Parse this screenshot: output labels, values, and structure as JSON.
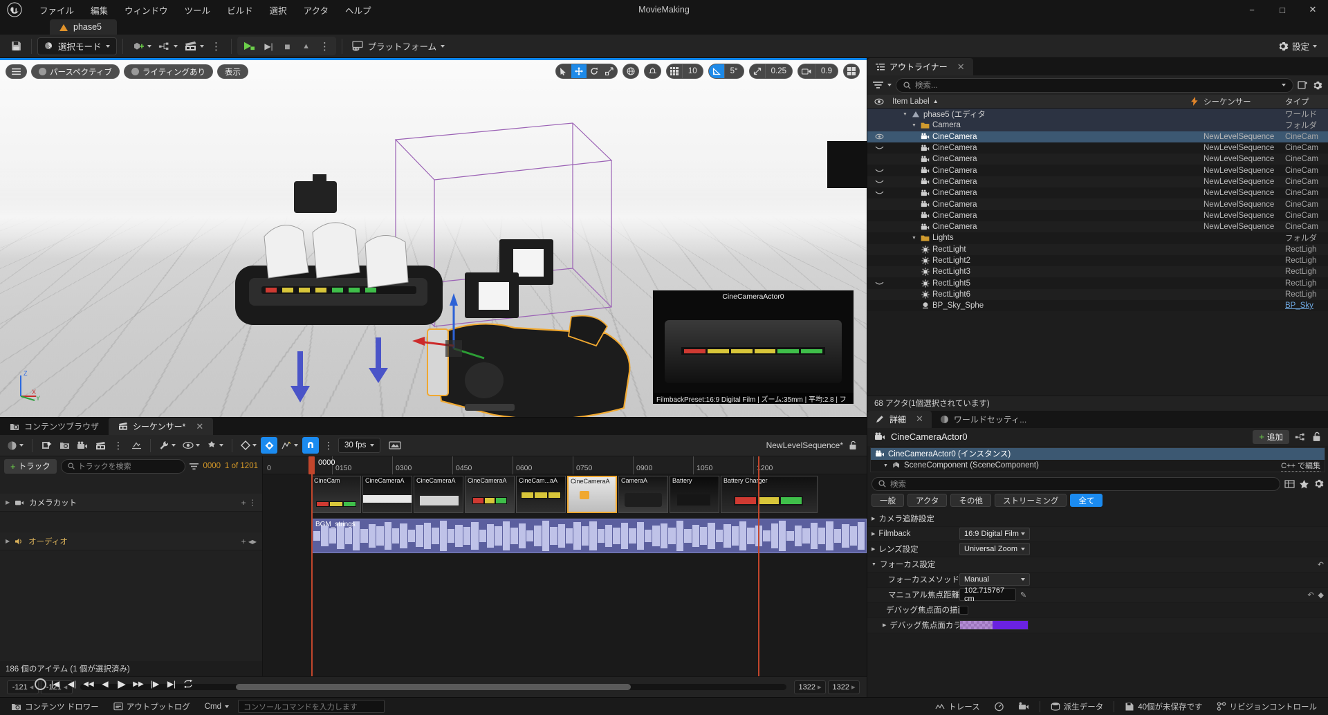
{
  "window": {
    "project_title": "MovieMaking",
    "menus": [
      "ファイル",
      "編集",
      "ウィンドウ",
      "ツール",
      "ビルド",
      "選択",
      "アクタ",
      "ヘルプ"
    ],
    "level_tab": "phase5",
    "minimize": "−",
    "maximize": "□",
    "close": "✕"
  },
  "toolbar": {
    "save_icon": "save-icon",
    "mode_label": "選択モード",
    "add_icon": "add-actor-icon",
    "blueprint_icon": "blueprint-icon",
    "sequencer_icon": "cinematics-icon",
    "play_icon": "▶",
    "skip_icon": "▶|",
    "stop_icon": "■",
    "eject_icon": "▲",
    "more_icon": "⋮",
    "platform_label": "プラットフォーム",
    "settings_label": "設定"
  },
  "viewport": {
    "perspective_label": "パースペクティブ",
    "lighting_label": "ライティングあり",
    "show_label": "表示",
    "controls": {
      "select_icon": "cursor-icon",
      "move_icon": "move-gizmo-icon",
      "rotate_icon": "rotate-gizmo-icon",
      "scale_icon": "scale-gizmo-icon",
      "world_icon": "world-space-icon",
      "surface_icon": "surface-snap-icon",
      "grid_snap_value": "10",
      "angle_snap_value": "5°",
      "scale_snap_value": "0.25",
      "camera_speed_value": "0.9",
      "layout_icon": "viewport-layout-icon"
    },
    "axis": {
      "x": "X",
      "y": "Y",
      "z": "Z"
    },
    "pip": {
      "title": "CineCameraActor0",
      "footer": "FilmbackPreset:16:9 Digital Film | ズーム:35mm | 平均:2.8 | フ"
    }
  },
  "sequencer": {
    "tabs": [
      {
        "label": "コンテンツブラウザ",
        "icon": "content-browser-icon",
        "active": false
      },
      {
        "label": "シーケンサー*",
        "icon": "sequencer-icon",
        "active": true,
        "close": "✕"
      }
    ],
    "toolbar": {
      "world_icon": "world-icon",
      "new_icon": "new-sequence-icon",
      "open_icon": "open-sequence-icon",
      "camera_icon": "create-camera-icon",
      "clapper_icon": "clapper-icon",
      "more_icon": "⋮",
      "actions_icon": "actions-icon",
      "wrench_icon": "wrench-icon",
      "eye_icon": "visibility-icon",
      "keyframe_opts_icon": "key-options-icon",
      "diamond_icon": "keyframe-icon",
      "auto_key_icon": "autokey-icon",
      "curve_icon": "curve-editor-icon",
      "snap_icon": "snap-magnet-icon",
      "fps_label": "30 fps",
      "render_icon": "render-movie-icon",
      "sequence_name": "NewLevelSequence*",
      "lock_icon": "unlock-icon"
    },
    "track_panel": {
      "add_track_label": "トラック",
      "search_placeholder": "トラックを検索",
      "filter_icon": "filter-icon",
      "current_frame": "0000",
      "frame_range": "1 of 1201",
      "tracks": [
        {
          "label": "カメラカット",
          "icon": "camera-cut-icon",
          "type": "camcut"
        },
        {
          "label": "オーディオ",
          "icon": "audio-icon",
          "type": "audio"
        }
      ],
      "status": "186 個のアイテム (1 個が選択済み)"
    },
    "ruler": {
      "ticks": [
        "0150",
        "0300",
        "0450",
        "0600",
        "0750",
        "0900",
        "1050",
        "1200"
      ],
      "playhead_label": "0000",
      "start_label": "0"
    },
    "shots": [
      {
        "name": "CineCam",
        "selected": false
      },
      {
        "name": "CineCameraA",
        "selected": false
      },
      {
        "name": "CineCameraA",
        "selected": false
      },
      {
        "name": "CineCameraA",
        "selected": false
      },
      {
        "name": "CineCam...aA",
        "selected": false
      },
      {
        "name": "CineCameraA",
        "selected": true
      },
      {
        "name": "CameraA",
        "selected": false
      },
      {
        "name": "Battery",
        "selected": false
      },
      {
        "name": "Battery Charger",
        "selected": false
      }
    ],
    "audio": {
      "label": "BGM_strings"
    },
    "transport": {
      "record_icon": "record-icon",
      "jump_start_icon": "|◀",
      "prev_key_icon": "◀|",
      "step_back_icon": "◀◀",
      "prev_icon": "◀",
      "play_icon": "▶",
      "next_icon": "▶▶",
      "next_key_icon": "|▶",
      "jump_end_icon": "▶|",
      "loop_icon": "loop-icon",
      "range_start": "-121",
      "range_start2": "-121",
      "range_end": "1322",
      "range_end2": "1322"
    }
  },
  "outliner": {
    "tab_label": "アウトライナー",
    "tab_icon": "outliner-icon",
    "tab_close": "✕",
    "filter_icon": "filter-icon",
    "search_placeholder": "検索...",
    "save_icon": "save-outliner-icon",
    "settings_icon": "gear-icon",
    "columns": {
      "eye": "visibility-icon",
      "item_label": "Item Label",
      "sort_asc": "▲",
      "bolt": "bolt-icon",
      "sequencer": "シーケンサー",
      "type": "タイプ"
    },
    "rows": [
      {
        "label": "phase5 (エディタ",
        "indent": 1,
        "icon": "world-icon",
        "arrow": "▼",
        "seq": "",
        "type": "ワールド",
        "eye": "",
        "state": "world"
      },
      {
        "label": "Camera",
        "indent": 2,
        "icon": "folder-icon",
        "arrow": "▼",
        "seq": "",
        "type": "フォルダ",
        "eye": "",
        "state": "world"
      },
      {
        "label": "CineCamera",
        "indent": 3,
        "icon": "camera-icon",
        "seq": "NewLevelSequence",
        "type": "CineCam",
        "eye": "open",
        "state": "selected"
      },
      {
        "label": "CineCamera",
        "indent": 3,
        "icon": "camera-icon",
        "seq": "NewLevelSequence",
        "type": "CineCam",
        "eye": "closed",
        "state": ""
      },
      {
        "label": "CineCamera",
        "indent": 3,
        "icon": "camera-icon",
        "seq": "NewLevelSequence",
        "type": "CineCam",
        "eye": "",
        "state": ""
      },
      {
        "label": "CineCamera",
        "indent": 3,
        "icon": "camera-icon",
        "seq": "NewLevelSequence",
        "type": "CineCam",
        "eye": "closed",
        "state": ""
      },
      {
        "label": "CineCamera",
        "indent": 3,
        "icon": "camera-icon",
        "seq": "NewLevelSequence",
        "type": "CineCam",
        "eye": "closed",
        "state": ""
      },
      {
        "label": "CineCamera",
        "indent": 3,
        "icon": "camera-icon",
        "seq": "NewLevelSequence",
        "type": "CineCam",
        "eye": "closed",
        "state": ""
      },
      {
        "label": "CineCamera",
        "indent": 3,
        "icon": "camera-icon",
        "seq": "NewLevelSequence",
        "type": "CineCam",
        "eye": "",
        "state": ""
      },
      {
        "label": "CineCamera",
        "indent": 3,
        "icon": "camera-icon",
        "seq": "NewLevelSequence",
        "type": "CineCam",
        "eye": "",
        "state": ""
      },
      {
        "label": "CineCamera",
        "indent": 3,
        "icon": "camera-icon",
        "seq": "NewLevelSequence",
        "type": "CineCam",
        "eye": "",
        "state": ""
      },
      {
        "label": "Lights",
        "indent": 2,
        "icon": "folder-icon",
        "arrow": "▼",
        "seq": "",
        "type": "フォルダ",
        "eye": "",
        "state": ""
      },
      {
        "label": "RectLight",
        "indent": 3,
        "icon": "light-icon",
        "seq": "",
        "type": "RectLigh",
        "eye": "",
        "state": ""
      },
      {
        "label": "RectLight2",
        "indent": 3,
        "icon": "light-icon",
        "seq": "",
        "type": "RectLigh",
        "eye": "",
        "state": ""
      },
      {
        "label": "RectLight3",
        "indent": 3,
        "icon": "light-icon",
        "seq": "",
        "type": "RectLigh",
        "eye": "",
        "state": ""
      },
      {
        "label": "RectLight5",
        "indent": 3,
        "icon": "light-icon",
        "seq": "",
        "type": "RectLigh",
        "eye": "closed",
        "state": ""
      },
      {
        "label": "RectLight6",
        "indent": 3,
        "icon": "light-icon",
        "seq": "",
        "type": "RectLigh",
        "eye": "",
        "state": ""
      },
      {
        "label": "BP_Sky_Sphe",
        "indent": 3,
        "icon": "sphere-icon",
        "seq": "",
        "type": "BP_Sky",
        "eye": "",
        "state": "link"
      }
    ],
    "footer": "68 アクタ(1個選択されています)"
  },
  "details": {
    "tabs": [
      {
        "label": "詳細",
        "icon": "details-icon",
        "active": true,
        "close": "✕"
      },
      {
        "label": "ワールドセッティ...",
        "icon": "world-settings-icon",
        "active": false
      }
    ],
    "actor_name": "CineCameraActor0",
    "actor_icon": "camera-icon",
    "add_label": "追加",
    "blueprint_icon": "blueprint-icon",
    "lock_icon": "unlock-icon",
    "components": [
      {
        "label": "CineCameraActor0 (インスタンス)",
        "icon": "camera-icon",
        "selected": true,
        "cpp": ""
      },
      {
        "label": "SceneComponent (SceneComponent)",
        "icon": "scene-component-icon",
        "selected": false,
        "cpp": "C++ で編集",
        "arrow": "▼"
      }
    ],
    "search_placeholder": "検索",
    "table_icon": "table-view-icon",
    "star_icon": "favorite-icon",
    "gear_icon": "gear-icon",
    "filters": [
      {
        "label": "一般",
        "active": false
      },
      {
        "label": "アクタ",
        "active": false
      },
      {
        "label": "その他",
        "active": false
      },
      {
        "label": "ストリーミング",
        "active": false
      },
      {
        "label": "全て",
        "active": true
      }
    ],
    "properties": [
      {
        "label": "カメラ追跡設定",
        "arrow": "▶",
        "kind": "group",
        "value": ""
      },
      {
        "label": "Filmback",
        "arrow": "▶",
        "kind": "combo",
        "value": "16:9 Digital Film"
      },
      {
        "label": "レンズ設定",
        "arrow": "▶",
        "kind": "combo",
        "value": "Universal Zoom"
      },
      {
        "label": "フォーカス設定",
        "arrow": "▼",
        "kind": "group-reset",
        "value": "",
        "reset_icon": "reset-icon"
      },
      {
        "label": "フォーカスメソッド",
        "arrow": "",
        "kind": "combo",
        "value": "Manual",
        "indent": 1
      },
      {
        "label": "マニュアル焦点距離",
        "arrow": "",
        "kind": "number",
        "value": "102.715767 cm",
        "indent": 1,
        "pick_icon": "eyedropper-icon",
        "reset_icon": "reset-icon",
        "key_icon": "add-key-icon"
      },
      {
        "label": "デバッグ焦点面の描画",
        "arrow": "",
        "kind": "checkbox",
        "value": "",
        "indent": 1
      },
      {
        "label": "デバッグ焦点面カラー",
        "arrow": "▶",
        "kind": "color",
        "value": "",
        "indent": 1
      }
    ]
  },
  "status_bar": {
    "content_drawer": "コンテンツ ドロワー",
    "content_drawer_icon": "drawer-icon",
    "output_log": "アウトプットログ",
    "output_log_icon": "log-icon",
    "cmd_label": "Cmd",
    "cmd_placeholder": "コンソールコマンドを入力します",
    "trace_label": "トレース",
    "trace_icon": "trace-icon",
    "perf_icon": "perf-icon",
    "camera_icon": "camera-status-icon",
    "derived_data": "派生データ",
    "derived_icon": "derived-data-icon",
    "unsaved": "40個が未保存です",
    "unsaved_icon": "unsaved-icon",
    "revision": "リビジョンコントロール",
    "revision_icon": "revision-icon"
  },
  "colors": {
    "accent_blue": "#1b8bf0",
    "selection_blue": "#3c5872",
    "orange": "#e0922a",
    "green": "#6ccf4a",
    "playhead_red": "#c2462c",
    "audio_purple": "#5b5f9e"
  }
}
